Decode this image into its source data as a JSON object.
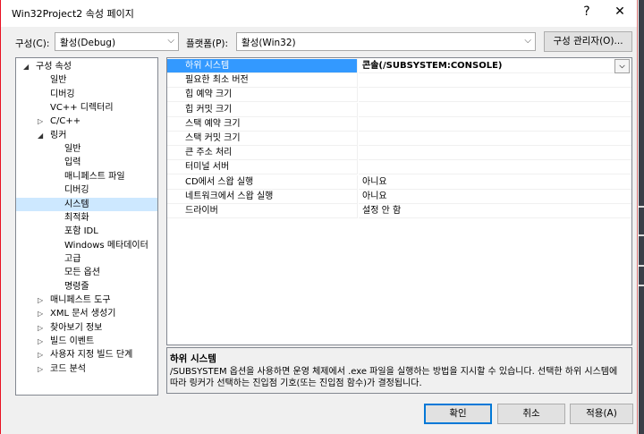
{
  "window": {
    "title": "Win32Project2 속성 페이지",
    "help_glyph": "?",
    "close_glyph": "✕"
  },
  "toolbar": {
    "config_label": "구성(C):",
    "config_value": "활성(Debug)",
    "platform_label": "플랫폼(P):",
    "platform_value": "활성(Win32)",
    "config_manager_label": "구성 관리자(O)..."
  },
  "tree": [
    {
      "label": "구성 속성",
      "level": 0,
      "expander": "◢",
      "selected": false
    },
    {
      "label": "일반",
      "level": 1,
      "expander": "",
      "selected": false
    },
    {
      "label": "디버깅",
      "level": 1,
      "expander": "",
      "selected": false
    },
    {
      "label": "VC++ 디렉터리",
      "level": 1,
      "expander": "",
      "selected": false
    },
    {
      "label": "C/C++",
      "level": 1,
      "expander": "▷",
      "selected": false
    },
    {
      "label": "링커",
      "level": 1,
      "expander": "◢",
      "selected": false
    },
    {
      "label": "일반",
      "level": 2,
      "expander": "",
      "selected": false
    },
    {
      "label": "입력",
      "level": 2,
      "expander": "",
      "selected": false
    },
    {
      "label": "매니페스트 파일",
      "level": 2,
      "expander": "",
      "selected": false
    },
    {
      "label": "디버깅",
      "level": 2,
      "expander": "",
      "selected": false
    },
    {
      "label": "시스템",
      "level": 2,
      "expander": "",
      "selected": true
    },
    {
      "label": "최적화",
      "level": 2,
      "expander": "",
      "selected": false
    },
    {
      "label": "포함 IDL",
      "level": 2,
      "expander": "",
      "selected": false
    },
    {
      "label": "Windows 메타데이터",
      "level": 2,
      "expander": "",
      "selected": false
    },
    {
      "label": "고급",
      "level": 2,
      "expander": "",
      "selected": false
    },
    {
      "label": "모든 옵션",
      "level": 2,
      "expander": "",
      "selected": false
    },
    {
      "label": "명령줄",
      "level": 2,
      "expander": "",
      "selected": false
    },
    {
      "label": "매니페스트 도구",
      "level": 1,
      "expander": "▷",
      "selected": false
    },
    {
      "label": "XML 문서 생성기",
      "level": 1,
      "expander": "▷",
      "selected": false
    },
    {
      "label": "찾아보기 정보",
      "level": 1,
      "expander": "▷",
      "selected": false
    },
    {
      "label": "빌드 이벤트",
      "level": 1,
      "expander": "▷",
      "selected": false
    },
    {
      "label": "사용자 지정 빌드 단계",
      "level": 1,
      "expander": "▷",
      "selected": false
    },
    {
      "label": "코드 분석",
      "level": 1,
      "expander": "▷",
      "selected": false
    }
  ],
  "properties": [
    {
      "name": "하위 시스템",
      "value": "콘솔(/SUBSYSTEM:CONSOLE)",
      "selected": true
    },
    {
      "name": "필요한 최소 버전",
      "value": "",
      "selected": false
    },
    {
      "name": "힙 예약 크기",
      "value": "",
      "selected": false
    },
    {
      "name": "힙 커밋 크기",
      "value": "",
      "selected": false
    },
    {
      "name": "스택 예약 크기",
      "value": "",
      "selected": false
    },
    {
      "name": "스택 커밋 크기",
      "value": "",
      "selected": false
    },
    {
      "name": "큰 주소 처리",
      "value": "",
      "selected": false
    },
    {
      "name": "터미널 서버",
      "value": "",
      "selected": false
    },
    {
      "name": "CD에서 스왑 실행",
      "value": "아니요",
      "selected": false
    },
    {
      "name": "네트워크에서 스왑 실행",
      "value": "아니요",
      "selected": false
    },
    {
      "name": "드라이버",
      "value": "설정 안 함",
      "selected": false
    }
  ],
  "description": {
    "title": "하위 시스템",
    "text": "/SUBSYSTEM 옵션을 사용하면 운영 체제에서 .exe 파일을 실행하는 방법을 지시할 수 있습니다. 선택한 하위 시스템에 따라 링커가 선택하는 진입점 기호(또는 진입점 함수)가 결정됩니다."
  },
  "buttons": {
    "ok": "확인",
    "cancel": "취소",
    "apply": "적용(A)"
  },
  "icons": {
    "dropdown": "chevron-down-icon"
  }
}
